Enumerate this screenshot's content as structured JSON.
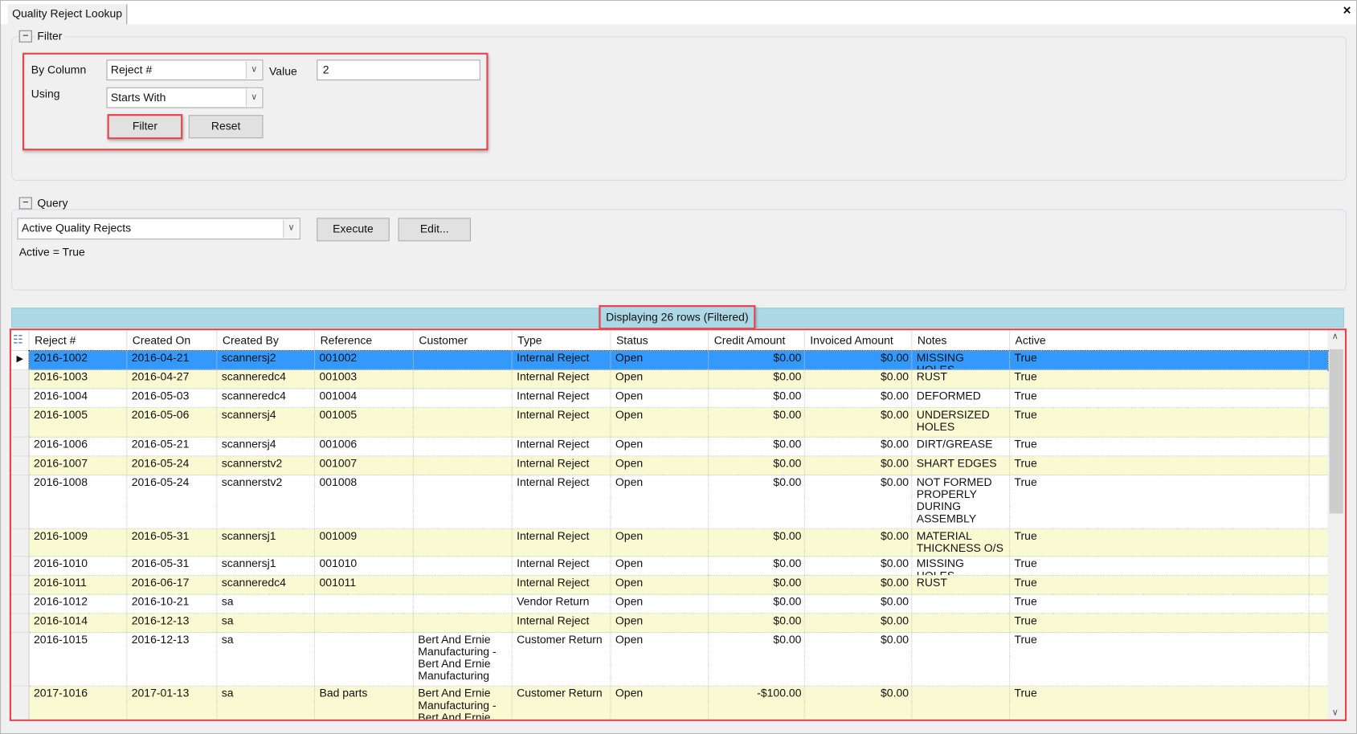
{
  "window": {
    "tab_title": "Quality Reject Lookup",
    "close_icon": "×"
  },
  "filter": {
    "title": "Filter",
    "collapse": "−",
    "by_column_label": "By Column",
    "by_column_value": "Reject #",
    "value_label": "Value",
    "value": "2",
    "using_label": "Using",
    "using_value": "Starts With",
    "filter_button": "Filter",
    "reset_button": "Reset"
  },
  "query": {
    "title": "Query",
    "collapse": "−",
    "selected": "Active Quality Rejects",
    "execute_button": "Execute",
    "edit_button": "Edit...",
    "condition": "Active = True"
  },
  "grid": {
    "status": "Displaying 26 rows (Filtered)",
    "colors": {
      "selected": "#3399ff",
      "alt_row": "#fafad2",
      "status_bar": "#add8e6",
      "highlight": "#e8424a"
    },
    "columns": [
      "Reject #",
      "Created On",
      "Created By",
      "Reference",
      "Customer",
      "Type",
      "Status",
      "Credit Amount",
      "Invoiced Amount",
      "Notes",
      "Active"
    ],
    "rows": [
      [
        "2016-1002",
        "2016-04-21",
        "scannersj2",
        "001002",
        "",
        "Internal Reject",
        "Open",
        "$0.00",
        "$0.00",
        "MISSING HOLES",
        "True"
      ],
      [
        "2016-1003",
        "2016-04-27",
        "scanneredc4",
        "001003",
        "",
        "Internal Reject",
        "Open",
        "$0.00",
        "$0.00",
        "RUST",
        "True"
      ],
      [
        "2016-1004",
        "2016-05-03",
        "scanneredc4",
        "001004",
        "",
        "Internal Reject",
        "Open",
        "$0.00",
        "$0.00",
        "DEFORMED",
        "True"
      ],
      [
        "2016-1005",
        "2016-05-06",
        "scannersj4",
        "001005",
        "",
        "Internal Reject",
        "Open",
        "$0.00",
        "$0.00",
        "UNDERSIZED HOLES",
        "True"
      ],
      [
        "2016-1006",
        "2016-05-21",
        "scannersj4",
        "001006",
        "",
        "Internal Reject",
        "Open",
        "$0.00",
        "$0.00",
        "DIRT/GREASE",
        "True"
      ],
      [
        "2016-1007",
        "2016-05-24",
        "scannerstv2",
        "001007",
        "",
        "Internal Reject",
        "Open",
        "$0.00",
        "$0.00",
        "SHART EDGES",
        "True"
      ],
      [
        "2016-1008",
        "2016-05-24",
        "scannerstv2",
        "001008",
        "",
        "Internal Reject",
        "Open",
        "$0.00",
        "$0.00",
        "NOT FORMED PROPERLY DURING ASSEMBLY",
        "True"
      ],
      [
        "2016-1009",
        "2016-05-31",
        "scannersj1",
        "001009",
        "",
        "Internal Reject",
        "Open",
        "$0.00",
        "$0.00",
        "MATERIAL THICKNESS O/S",
        "True"
      ],
      [
        "2016-1010",
        "2016-05-31",
        "scannersj1",
        "001010",
        "",
        "Internal Reject",
        "Open",
        "$0.00",
        "$0.00",
        "MISSING HOLES",
        "True"
      ],
      [
        "2016-1011",
        "2016-06-17",
        "scanneredc4",
        "001011",
        "",
        "Internal Reject",
        "Open",
        "$0.00",
        "$0.00",
        "RUST",
        "True"
      ],
      [
        "2016-1012",
        "2016-10-21",
        "sa",
        "",
        "",
        "Vendor Return",
        "Open",
        "$0.00",
        "$0.00",
        "",
        "True"
      ],
      [
        "2016-1014",
        "2016-12-13",
        "sa",
        "",
        "",
        "Internal Reject",
        "Open",
        "$0.00",
        "$0.00",
        "",
        "True"
      ],
      [
        "2016-1015",
        "2016-12-13",
        "sa",
        "",
        "Bert And Ernie Manufacturing - Bert And Ernie Manufacturing",
        "Customer Return",
        "Open",
        "$0.00",
        "$0.00",
        "",
        "True"
      ],
      [
        "2017-1016",
        "2017-01-13",
        "sa",
        "Bad parts",
        "Bert And Ernie Manufacturing - Bert And Ernie Manufacturing",
        "Customer Return",
        "Open",
        "-$100.00",
        "$0.00",
        "",
        "True"
      ]
    ]
  }
}
